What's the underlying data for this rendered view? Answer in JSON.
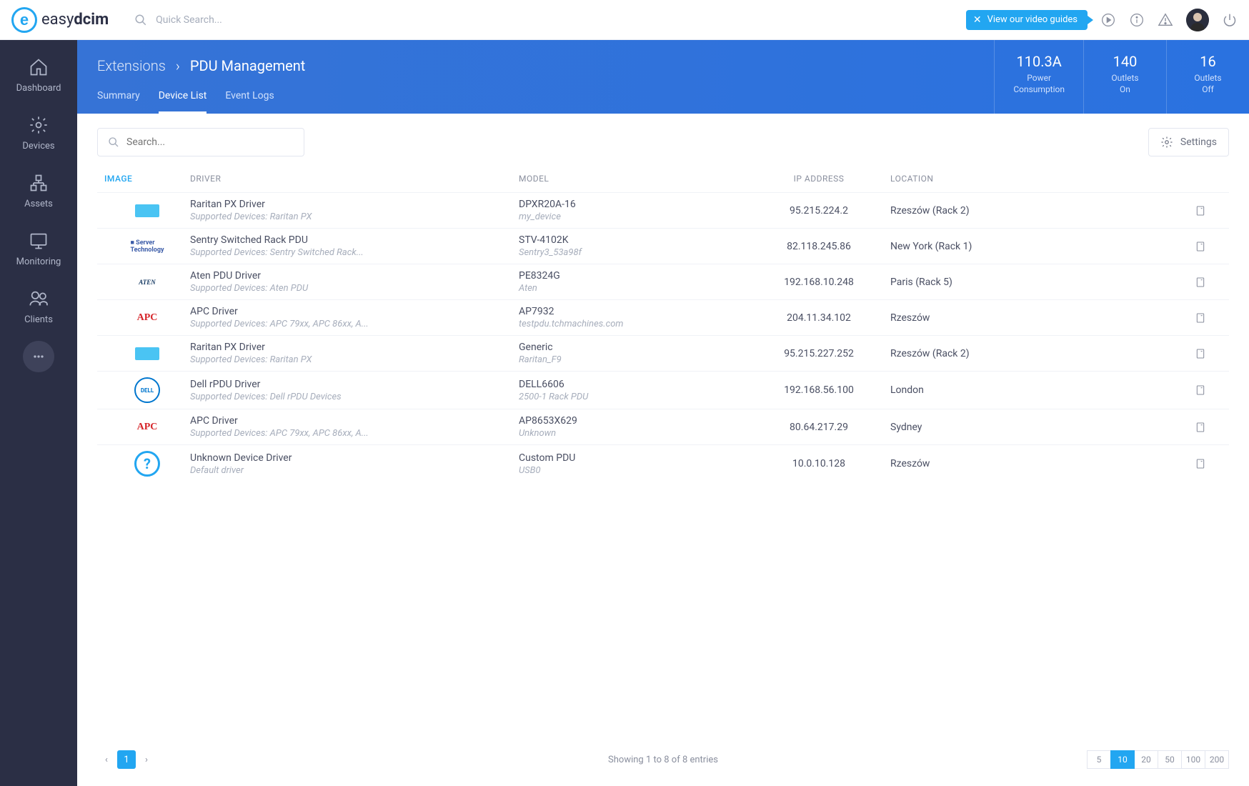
{
  "brand": {
    "name_light": "easy",
    "name_bold": "dcim"
  },
  "top": {
    "search_placeholder": "Quick Search...",
    "video_guide": "View our video guides"
  },
  "sidebar": {
    "items": [
      {
        "label": "Dashboard"
      },
      {
        "label": "Devices"
      },
      {
        "label": "Assets"
      },
      {
        "label": "Monitoring"
      },
      {
        "label": "Clients"
      }
    ]
  },
  "breadcrumb": {
    "parent": "Extensions",
    "current": "PDU Management"
  },
  "stats": [
    {
      "value": "110.3A",
      "label": "Power Consumption"
    },
    {
      "value": "140",
      "label": "Outlets On"
    },
    {
      "value": "16",
      "label": "Outlets Off"
    }
  ],
  "tabs": [
    {
      "label": "Summary",
      "active": false
    },
    {
      "label": "Device List",
      "active": true
    },
    {
      "label": "Event Logs",
      "active": false
    }
  ],
  "toolbar": {
    "search_placeholder": "Search...",
    "settings": "Settings"
  },
  "columns": {
    "image": "IMAGE",
    "driver": "DRIVER",
    "model": "MODEL",
    "ip": "IP ADDRESS",
    "location": "LOCATION"
  },
  "rows": [
    {
      "logo": "raritan",
      "driver": "Raritan PX Driver",
      "driver_sub": "Supported Devices: Raritan PX",
      "model": "DPXR20A-16",
      "model_sub": "my_device",
      "ip": "95.215.224.2",
      "location": "Rzeszów (Rack 2)"
    },
    {
      "logo": "sentry",
      "driver": "Sentry Switched Rack PDU",
      "driver_sub": "Supported Devices: Sentry Switched Rack...",
      "model": "STV-4102K",
      "model_sub": "Sentry3_53a98f",
      "ip": "82.118.245.86",
      "location": "New York (Rack 1)"
    },
    {
      "logo": "aten",
      "driver": "Aten PDU Driver",
      "driver_sub": "Supported Devices: Aten PDU",
      "model": "PE8324G",
      "model_sub": "Aten",
      "ip": "192.168.10.248",
      "location": "Paris (Rack 5)"
    },
    {
      "logo": "apc",
      "driver": "APC Driver",
      "driver_sub": "Supported Devices: APC 79xx, APC 86xx, A...",
      "model": "AP7932",
      "model_sub": "testpdu.tchmachines.com",
      "ip": "204.11.34.102",
      "location": "Rzeszów"
    },
    {
      "logo": "raritan",
      "driver": "Raritan PX Driver",
      "driver_sub": "Supported Devices: Raritan PX",
      "model": "Generic",
      "model_sub": "Raritan_F9",
      "ip": "95.215.227.252",
      "location": "Rzeszów (Rack 2)"
    },
    {
      "logo": "dell",
      "driver": "Dell rPDU Driver",
      "driver_sub": "Supported Devices: Dell rPDU Devices",
      "model": "DELL6606",
      "model_sub": "2500-1 Rack PDU",
      "ip": "192.168.56.100",
      "location": "London"
    },
    {
      "logo": "apc",
      "driver": "APC Driver",
      "driver_sub": "Supported Devices: APC 79xx, APC 86xx, A...",
      "model": "AP8653X629",
      "model_sub": "Unknown",
      "ip": "80.64.217.29",
      "location": "Sydney"
    },
    {
      "logo": "unknown",
      "driver": "Unknown Device Driver",
      "driver_sub": "Default driver",
      "model": "Custom PDU",
      "model_sub": "USB0",
      "ip": "10.0.10.128",
      "location": "Rzeszów"
    }
  ],
  "pagination": {
    "current": "1",
    "info": "Showing 1 to 8 of 8 entries",
    "sizes": [
      "5",
      "10",
      "20",
      "50",
      "100",
      "200"
    ],
    "active_size": "10"
  }
}
